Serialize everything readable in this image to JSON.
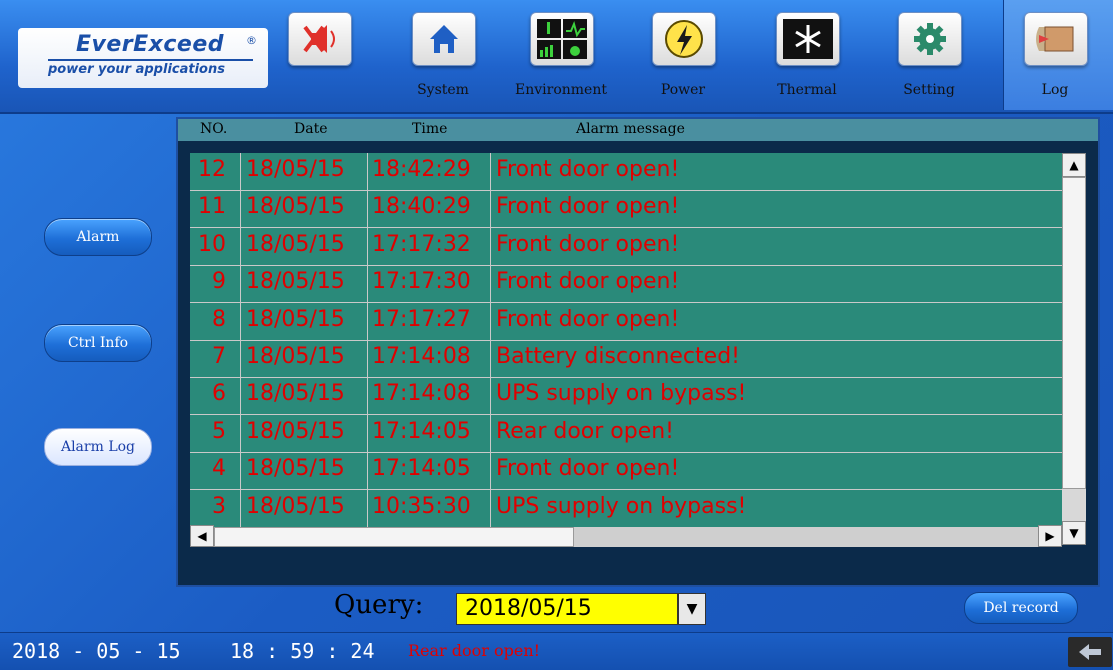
{
  "brand": {
    "name": "EverExceed",
    "registered": "®",
    "tagline": "power your applications"
  },
  "nav": {
    "items": [
      {
        "key": "mute",
        "label": "",
        "icon": "speaker-muted-icon"
      },
      {
        "key": "system",
        "label": "System",
        "icon": "home-icon"
      },
      {
        "key": "environment",
        "label": "Environment",
        "icon": "environment-panels-icon"
      },
      {
        "key": "power",
        "label": "Power",
        "icon": "lightning-icon"
      },
      {
        "key": "thermal",
        "label": "Thermal",
        "icon": "snowflake-icon"
      },
      {
        "key": "setting",
        "label": "Setting",
        "icon": "gear-icon"
      },
      {
        "key": "log",
        "label": "Log",
        "icon": "log-icon",
        "active": true
      }
    ]
  },
  "sidebar": {
    "items": [
      {
        "label": "Alarm",
        "active": false
      },
      {
        "label": "Ctrl Info",
        "active": false
      },
      {
        "label": "Alarm Log",
        "active": true
      }
    ]
  },
  "table": {
    "columns": [
      "NO.",
      "Date",
      "Time",
      "Alarm message"
    ],
    "rows": [
      {
        "no": "12",
        "date": "18/05/15",
        "time": "18:42:29",
        "message": "Front door open!"
      },
      {
        "no": "11",
        "date": "18/05/15",
        "time": "18:40:29",
        "message": "Front door open!"
      },
      {
        "no": "10",
        "date": "18/05/15",
        "time": "17:17:32",
        "message": "Front door open!"
      },
      {
        "no": "9",
        "date": "18/05/15",
        "time": "17:17:30",
        "message": "Front door open!"
      },
      {
        "no": "8",
        "date": "18/05/15",
        "time": "17:17:27",
        "message": "Front door open!"
      },
      {
        "no": "7",
        "date": "18/05/15",
        "time": "17:14:08",
        "message": "Battery disconnected!"
      },
      {
        "no": "6",
        "date": "18/05/15",
        "time": "17:14:08",
        "message": "UPS supply on bypass!"
      },
      {
        "no": "5",
        "date": "18/05/15",
        "time": "17:14:05",
        "message": "Rear door open!"
      },
      {
        "no": "4",
        "date": "18/05/15",
        "time": "17:14:05",
        "message": "Front door open!"
      },
      {
        "no": "3",
        "date": "18/05/15",
        "time": "10:35:30",
        "message": "UPS supply on bypass!"
      }
    ]
  },
  "query": {
    "label": "Query:",
    "value": "2018/05/15"
  },
  "actions": {
    "del_record": "Del record"
  },
  "status": {
    "date": "2018 - 05 - 15",
    "time": "18 : 59 : 24",
    "alarm": "Rear door open!"
  },
  "colors": {
    "alarm_text": "#e00000",
    "list_bg": "#2a8a7a",
    "query_bg": "#ffff00"
  }
}
